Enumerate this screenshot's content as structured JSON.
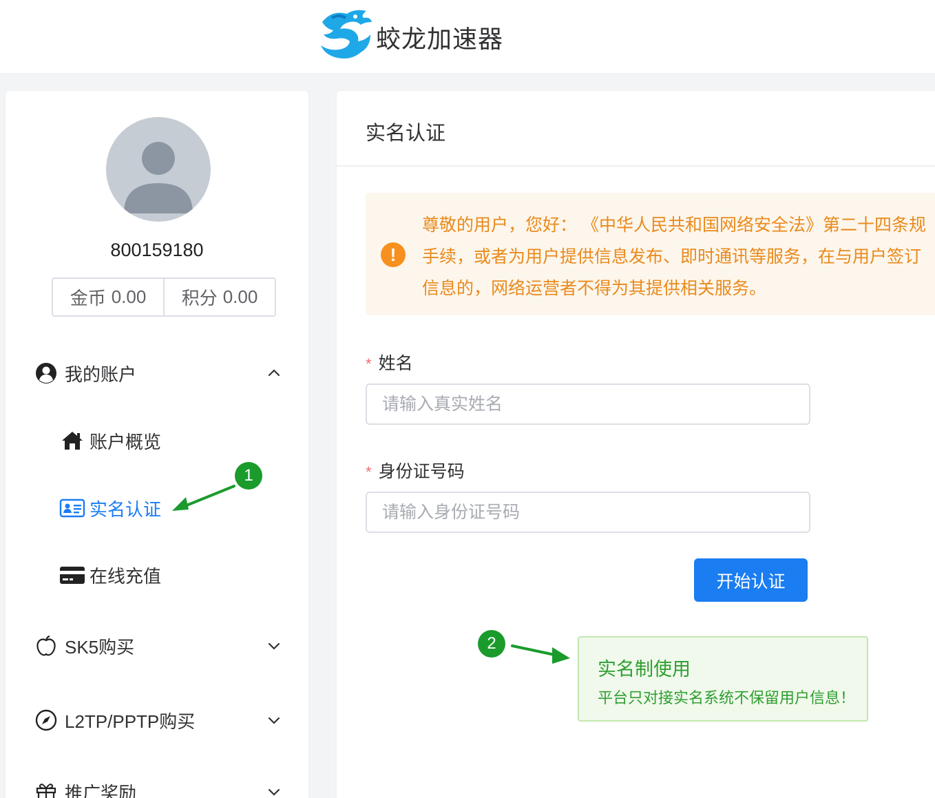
{
  "header": {
    "brand": "蛟龙加速器",
    "logo_icon": "dragon-logo-icon"
  },
  "sidebar": {
    "username": "800159180",
    "coins_label": "金币",
    "coins_value": "0.00",
    "points_label": "积分",
    "points_value": "0.00",
    "groups": [
      {
        "label": "我的账户",
        "icon": "user-circle-icon",
        "expanded": true
      },
      {
        "label": "SK5购买",
        "icon": "apple-icon",
        "expanded": false
      },
      {
        "label": "L2TP/PPTP购买",
        "icon": "compass-icon",
        "expanded": false
      },
      {
        "label": "推广奖励",
        "icon": "gift-icon",
        "expanded": false
      }
    ],
    "items": [
      {
        "label": "账户概览",
        "icon": "home-icon"
      },
      {
        "label": "实名认证",
        "icon": "id-card-icon",
        "active": true
      },
      {
        "label": "在线充值",
        "icon": "credit-card-icon"
      }
    ]
  },
  "main": {
    "title": "实名认证",
    "notice": {
      "lines": [
        "尊敬的用户，您好：  《中华人民共和国网络安全法》第二十四条规",
        "手续，或者为用户提供信息发布、即时通讯等服务，在与用户签订",
        "信息的，网络运营者不得为其提供相关服务。"
      ]
    },
    "form": {
      "name_label": "姓名",
      "name_placeholder": "请输入真实姓名",
      "id_label": "身份证号码",
      "id_placeholder": "请输入身份证号码",
      "required_mark": "*",
      "submit_label": "开始认证"
    },
    "tip": {
      "title": "实名制使用",
      "text": "平台只对接实名系统不保留用户信息！"
    }
  },
  "annotations": {
    "step1": "1",
    "step2": "2"
  },
  "colors": {
    "primary": "#1a7df2",
    "warning": "#e6a23c",
    "success": "#2e9e30",
    "badge": "#1a9b2c"
  }
}
